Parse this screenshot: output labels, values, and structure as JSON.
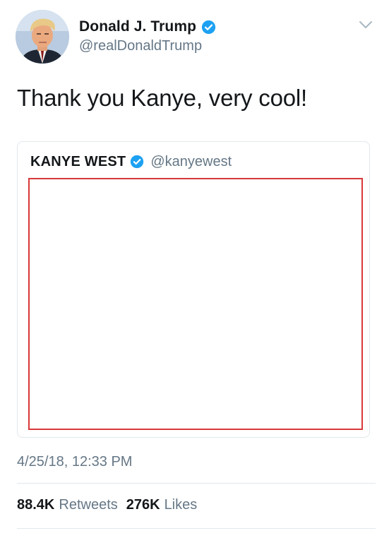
{
  "author": {
    "display_name": "Donald J. Trump",
    "handle": "@realDonaldTrump",
    "verified": true,
    "avatar_icon": "profile-photo"
  },
  "tweet": {
    "text": "Thank you Kanye, very cool!",
    "timestamp": "4/25/18, 12:33 PM"
  },
  "quoted_tweet": {
    "display_name": "KANYE WEST",
    "handle": "@kanyewest",
    "verified": true,
    "media_border_color": "#d93838"
  },
  "stats": {
    "retweets_count": "88.4K",
    "retweets_label": "Retweets",
    "likes_count": "276K",
    "likes_label": "Likes"
  },
  "colors": {
    "verified_blue": "#1da1f2",
    "secondary_text": "#657786",
    "primary_text": "#14171a",
    "divider": "#e1e8ed"
  }
}
